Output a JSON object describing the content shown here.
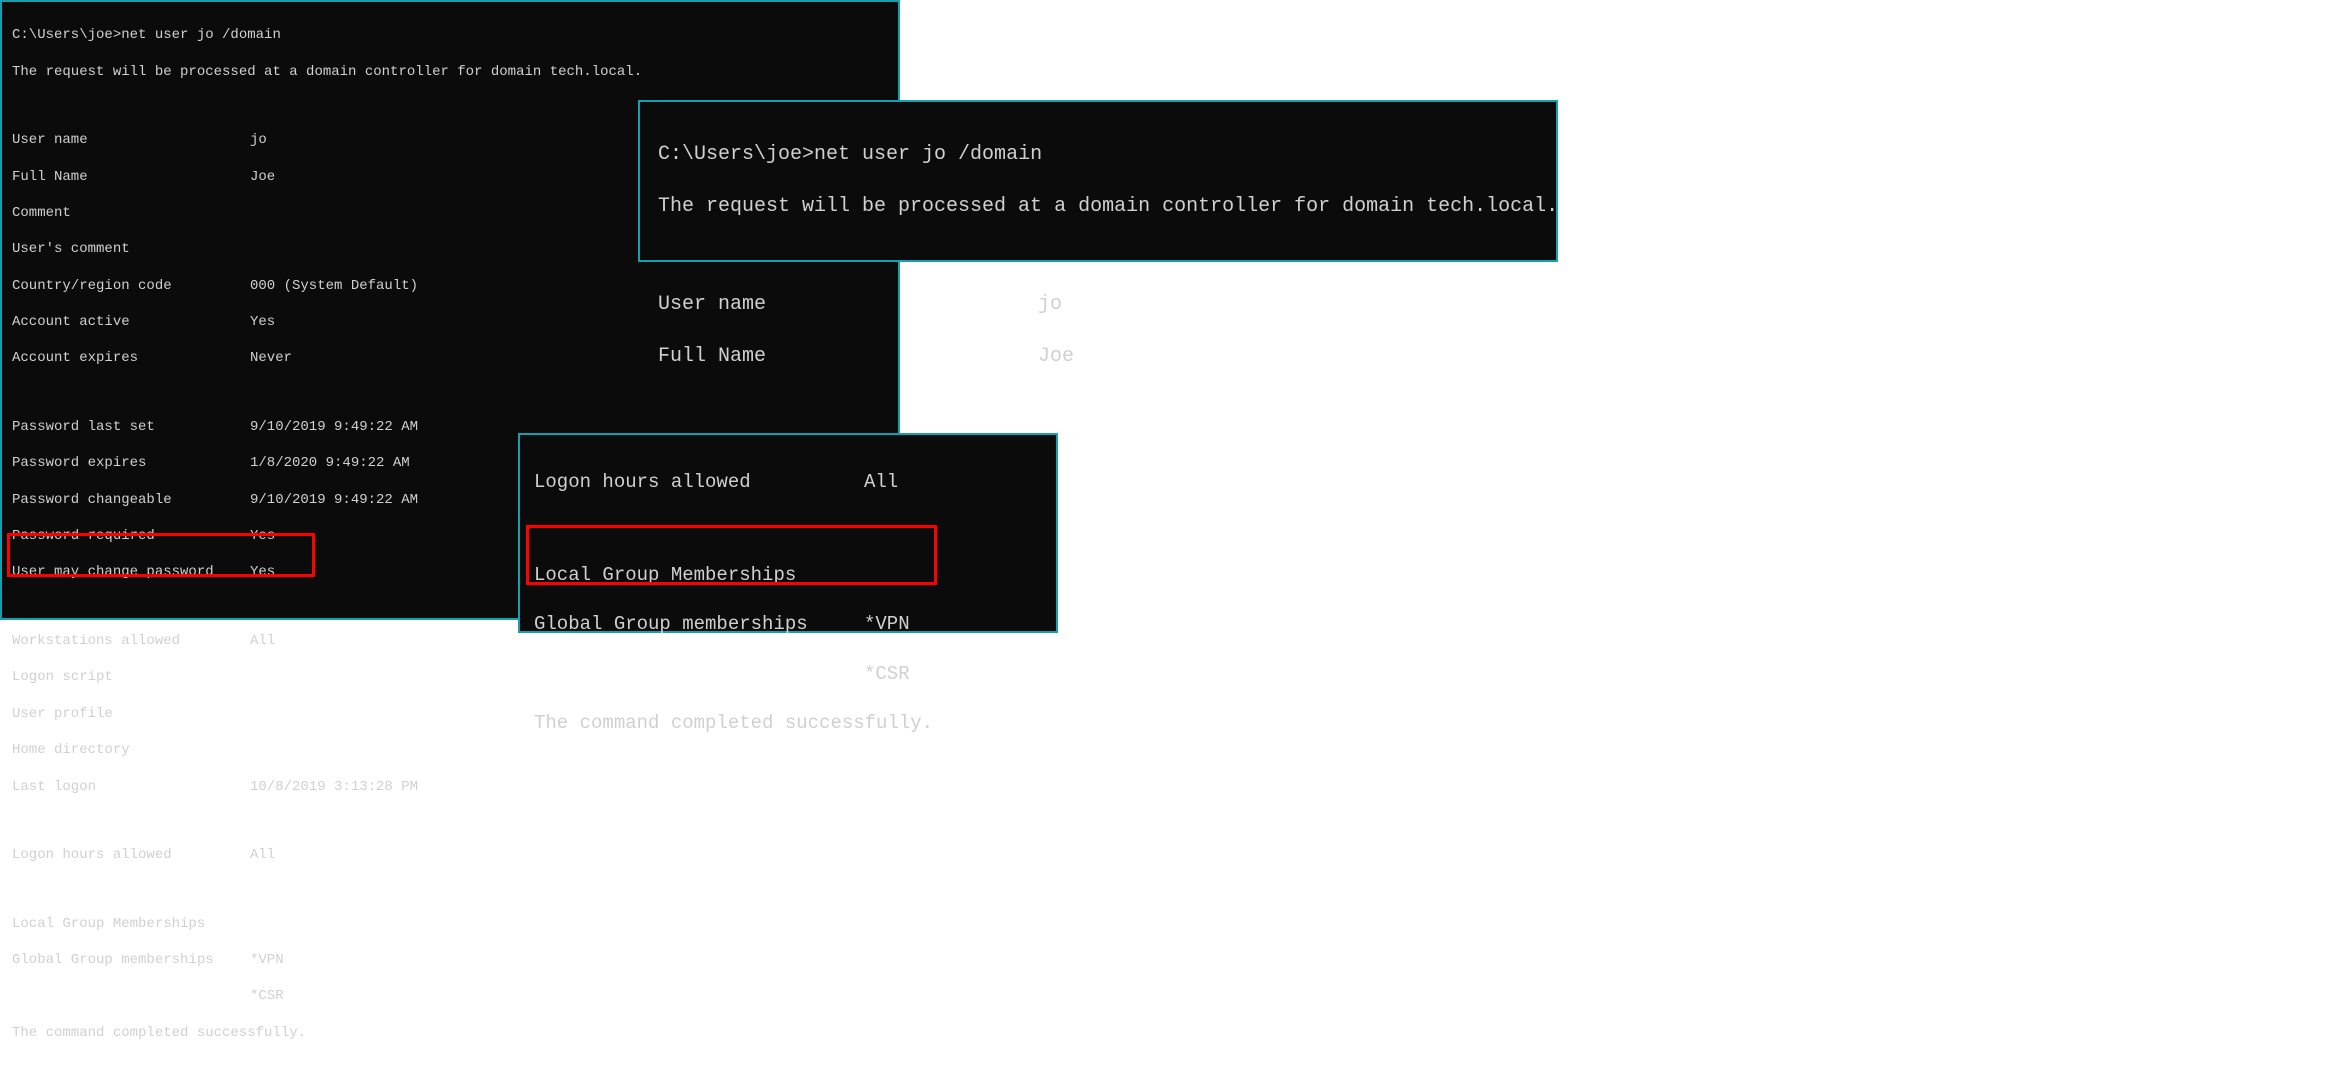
{
  "prompt": "C:\\Users\\joe>",
  "command": "net user jo /domain",
  "request_msg": "The request will be processed at a domain controller for domain tech.local.",
  "fields": {
    "user_name": {
      "label": "User name",
      "value": "jo"
    },
    "full_name": {
      "label": "Full Name",
      "value": "Joe"
    },
    "comment": {
      "label": "Comment",
      "value": ""
    },
    "users_comment": {
      "label": "User's comment",
      "value": ""
    },
    "country_code": {
      "label": "Country/region code",
      "value": "000 (System Default)"
    },
    "account_active": {
      "label": "Account active",
      "value": "Yes"
    },
    "account_expires": {
      "label": "Account expires",
      "value": "Never"
    },
    "password_last_set": {
      "label": "Password last set",
      "value": "9/10/2019 9:49:22 AM"
    },
    "password_expires": {
      "label": "Password expires",
      "value": "1/8/2020 9:49:22 AM"
    },
    "password_changeable": {
      "label": "Password changeable",
      "value": "9/10/2019 9:49:22 AM"
    },
    "password_required": {
      "label": "Password required",
      "value": "Yes"
    },
    "user_may_change": {
      "label": "User may change password",
      "value": "Yes"
    },
    "workstations_allowed": {
      "label": "Workstations allowed",
      "value": "All"
    },
    "logon_script": {
      "label": "Logon script",
      "value": ""
    },
    "user_profile": {
      "label": "User profile",
      "value": ""
    },
    "home_directory": {
      "label": "Home directory",
      "value": ""
    },
    "last_logon": {
      "label": "Last logon",
      "value": "10/8/2019 3:13:28 PM"
    },
    "logon_hours": {
      "label": "Logon hours allowed",
      "value": "All"
    },
    "local_group": {
      "label": "Local Group Memberships",
      "value": ""
    },
    "global_group": {
      "label": "Global Group memberships",
      "value": "*VPN"
    },
    "global_group2": {
      "label": "",
      "value": "*CSR"
    }
  },
  "completed_msg": "The command completed successfully."
}
